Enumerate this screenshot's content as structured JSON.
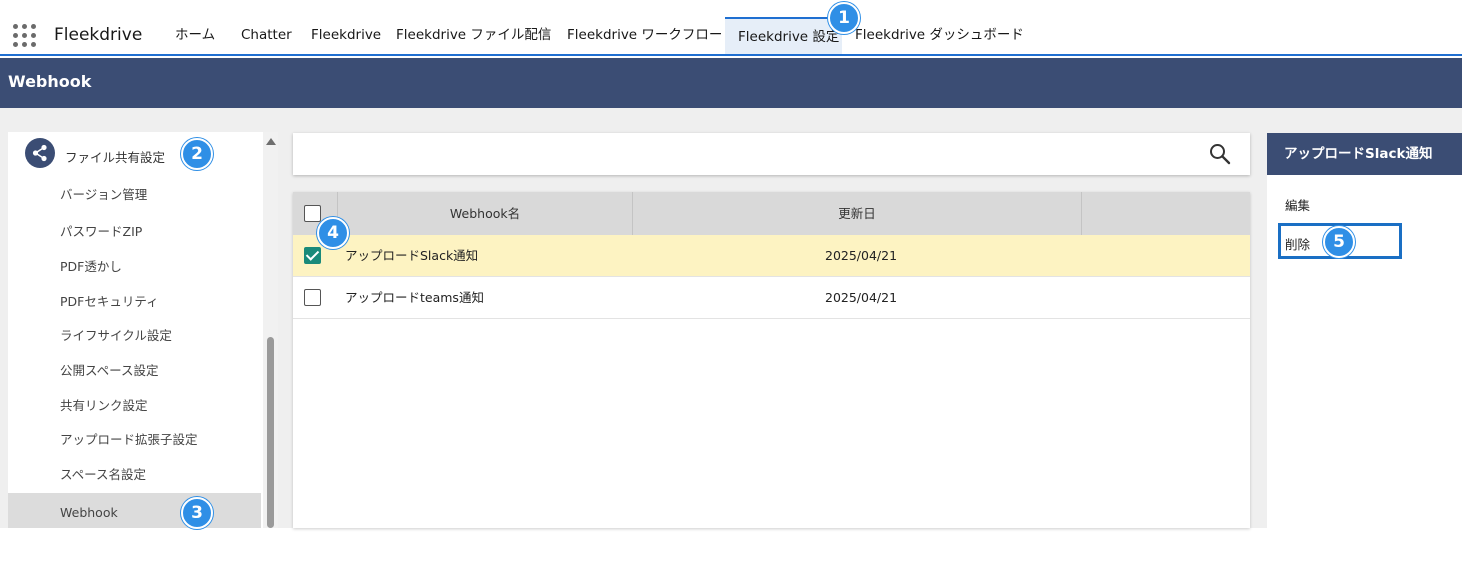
{
  "topnav": {
    "app_name": "Fleekdrive",
    "tabs": [
      {
        "label": "ホーム"
      },
      {
        "label": "Chatter"
      },
      {
        "label": "Fleekdrive"
      },
      {
        "label": "Fleekdrive ファイル配信"
      },
      {
        "label": "Fleekdrive ワークフロー"
      },
      {
        "label": "Fleekdrive 設定",
        "active": true
      },
      {
        "label": "Fleekdrive ダッシュボード"
      }
    ]
  },
  "header": {
    "title": "Webhook"
  },
  "sidebar": {
    "section_label": "ファイル共有設定",
    "items": [
      {
        "label": "バージョン管理"
      },
      {
        "label": "パスワードZIP"
      },
      {
        "label": "PDF透かし"
      },
      {
        "label": "PDFセキュリティ"
      },
      {
        "label": "ライフサイクル設定"
      },
      {
        "label": "公開スペース設定"
      },
      {
        "label": "共有リンク設定"
      },
      {
        "label": "アップロード拡張子設定"
      },
      {
        "label": "スペース名設定"
      },
      {
        "label": "Webhook",
        "selected": true
      }
    ]
  },
  "table": {
    "columns": [
      "Webhook名",
      "更新日"
    ],
    "rows": [
      {
        "name": "アップロードSlack通知",
        "date": "2025/04/21",
        "checked": true
      },
      {
        "name": "アップロードteams通知",
        "date": "2025/04/21",
        "checked": false
      }
    ]
  },
  "right_panel": {
    "title": "アップロードSlack通知",
    "actions": {
      "edit": "編集",
      "delete": "削除"
    }
  },
  "badges": [
    "1",
    "2",
    "3",
    "4",
    "5"
  ],
  "colors": {
    "header_bg": "#3b4d74",
    "accent": "#1f6fd1",
    "badge": "#2f8fe6",
    "row_selected": "#fdf3c2",
    "check": "#1a8a7a"
  }
}
